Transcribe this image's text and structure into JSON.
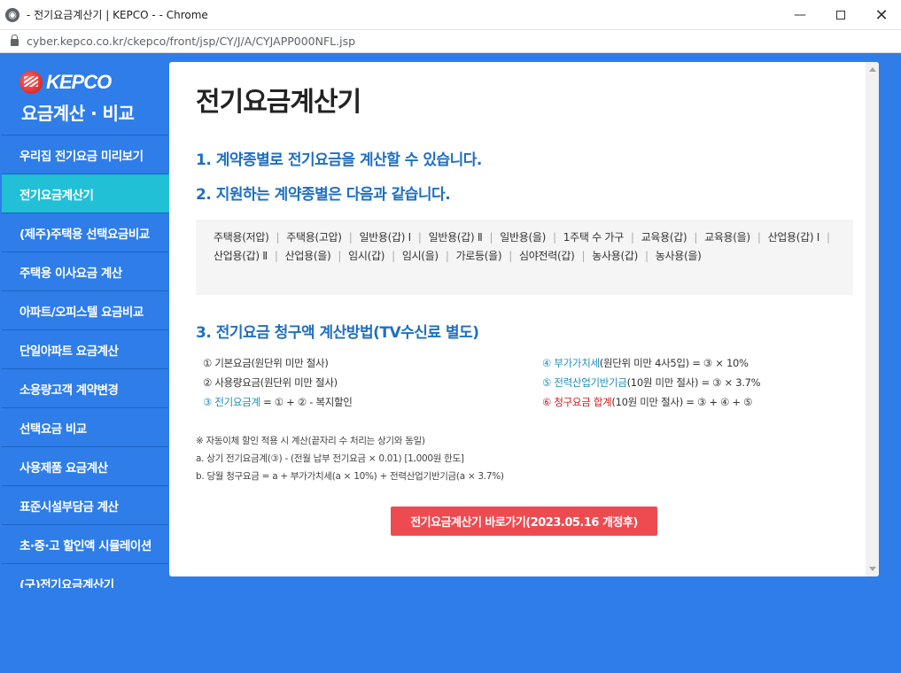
{
  "browser": {
    "title": "- 전기요금계산기 | KEPCO - - Chrome",
    "url": "cyber.kepco.co.kr/ckepco/front/jsp/CY/J/A/CYJAPP000NFL.jsp",
    "minimize_glyph": "—",
    "close_glyph": "✕"
  },
  "sidebar": {
    "logo_text": "KEPCO",
    "logo_sub": "요금계산 · 비교",
    "items": [
      {
        "label": "우리집 전기요금 미리보기"
      },
      {
        "label": "전기요금계산기"
      },
      {
        "label": "(제주)주택용 선택요금비교"
      },
      {
        "label": "주택용 이사요금 계산"
      },
      {
        "label": "아파트/오피스텔 요금비교"
      },
      {
        "label": "단일아파트 요금계산"
      },
      {
        "label": "소용량고객 계약변경"
      },
      {
        "label": "선택요금 비교"
      },
      {
        "label": "사용제품 요금계산"
      },
      {
        "label": "표준시설부담금 계산"
      },
      {
        "label": "초·중·고 할인액 시뮬레이션"
      },
      {
        "label": "(구)전기요금계산기"
      }
    ],
    "active_index": 1
  },
  "content": {
    "title": "전기요금계산기",
    "section1": "1. 계약종별로 전기요금을 계산할 수 있습니다.",
    "section2": "2. 지원하는 계약종별은 다음과 같습니다.",
    "contract_types": [
      "주택용(저압)",
      "주택용(고압)",
      "일반용(갑) Ⅰ",
      "일반용(갑) Ⅱ",
      "일반용(을)",
      "1주택 수 가구",
      "교육용(갑)",
      "교육용(을)",
      "산업용(갑) Ⅰ",
      "산업용(갑) Ⅱ",
      "산업용(을)",
      "임시(갑)",
      "임시(을)",
      "가로등(을)",
      "심야전력(갑)",
      "농사용(갑)",
      "농사용(을)"
    ],
    "section3": "3. 전기요금 청구액 계산방법(TV수신료 별도)",
    "formulas": {
      "f1": "① 기본요금(원단위 미만 절사)",
      "f2": "② 사용량요금(원단위 미만 절사)",
      "f3_label": "③ 전기요금계",
      "f3_rest": " = ① + ② - 복지할인",
      "f4_label": "④ 부가가치세",
      "f4_rest": "(원단위 미만 4사5입) = ③ × 10%",
      "f5_label": "⑤ 전력산업기반기금",
      "f5_rest": "(10원 미만 절사) = ③ × 3.7%",
      "f6_label": "⑥ 청구요금 합계",
      "f6_rest": "(10원 미만 절사) = ③ + ④ + ⑤"
    },
    "notes": {
      "n1": "※ 자동이체 할인 적용 시 계산(끝자리 수 처리는 상기와 동일)",
      "n2": "a. 상기 전기요금계(③) - (전월 납부 전기요금 × 0.01) [1,000원 한도]",
      "n3": "b. 당월 청구요금 = a + 부가가치세(a × 10%) + 전력산업기반기금(a × 3.7%)"
    },
    "cta_label": "전기요금계산기 바로가기(2023.05.16 개정후)"
  },
  "colors": {
    "sidebar_bg": "#2e7de9",
    "active_bg": "#21c0d6",
    "heading_blue": "#1f6fbf",
    "cta_red": "#ee4b50"
  }
}
